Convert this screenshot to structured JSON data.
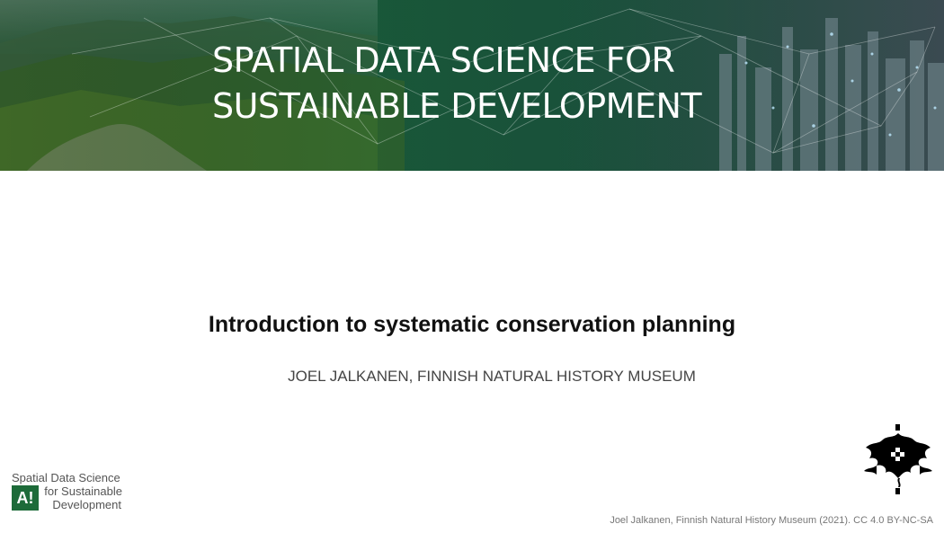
{
  "banner": {
    "title_line1": "SPATIAL DATA SCIENCE FOR",
    "title_line2": "SUSTAINABLE DEVELOPMENT"
  },
  "slide": {
    "title": "Introduction to systematic conservation planning",
    "subtitle": "JOEL JALKANEN, FINNISH NATURAL HISTORY MUSEUM"
  },
  "course_logo": {
    "line1": "Spatial Data Science",
    "badge": "A!",
    "line2": "for Sustainable",
    "line3": "Development"
  },
  "footer": {
    "credit": "Joel Jalkanen, Finnish Natural History Museum (2021). CC 4.0 BY-NC-SA"
  },
  "colors": {
    "banner_green": "#1f5d3d",
    "badge_green": "#1d6b39",
    "title_text": "#111111",
    "subtitle_text": "#444444"
  },
  "icons": {
    "university_logo": "helsinki-flame-seal-icon",
    "course_badge": "aalto-a-icon"
  }
}
